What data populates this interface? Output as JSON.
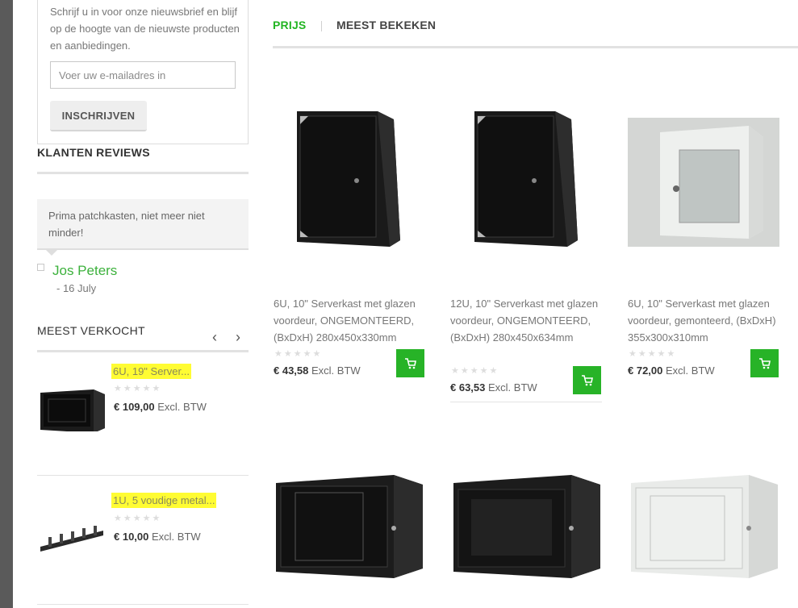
{
  "newsletter": {
    "text": "Schrijf u in voor onze nieuwsbrief en blijf op de hoogte van de nieuwste producten en aanbiedingen.",
    "placeholder": "Voer uw e-mailadres in",
    "button": "INSCHRIJVEN"
  },
  "reviews": {
    "title": "KLANTEN REVIEWS",
    "text": "Prima patchkasten, niet meer niet minder!",
    "author": "Jos Peters",
    "date": "- 16 July"
  },
  "bestsellers": {
    "title": "MEEST VERKOCHT",
    "prev": "‹",
    "next": "›",
    "items": [
      {
        "name": "6U, 19\" Server...",
        "stars": "★★★★★",
        "price": "€ 109,00",
        "tax": "Excl. BTW"
      },
      {
        "name": "1U, 5 voudige metal...",
        "stars": "★★★★★",
        "price": "€ 10,00",
        "tax": "Excl. BTW"
      }
    ]
  },
  "tabs": [
    {
      "label": "PRIJS",
      "active": true
    },
    {
      "label": "MEEST BEKEKEN",
      "active": false
    }
  ],
  "products": [
    {
      "title": "6U, 10\" Serverkast met glazen voordeur, ONGEMONTEERD, (BxDxH) 280x450x330mm",
      "stars": "★★★★★",
      "price": "€ 43,58",
      "tax": "Excl. BTW"
    },
    {
      "title": "12U, 10\" Serverkast met glazen voordeur, ONGEMONTEERD, (BxDxH) 280x450x634mm",
      "stars": "★★★★★",
      "price": "€ 63,53",
      "tax": "Excl. BTW"
    },
    {
      "title": "6U, 10\" Serverkast met glazen voordeur, gemonteerd, (BxDxH) 355x300x310mm",
      "stars": "★★★★★",
      "price": "€ 72,00",
      "tax": "Excl. BTW"
    }
  ],
  "colors": {
    "accent": "#27b327",
    "highlight": "#fffc33"
  },
  "icons": {
    "cart": "cart-icon",
    "prev": "chevron-left-icon",
    "next": "chevron-right-icon"
  }
}
